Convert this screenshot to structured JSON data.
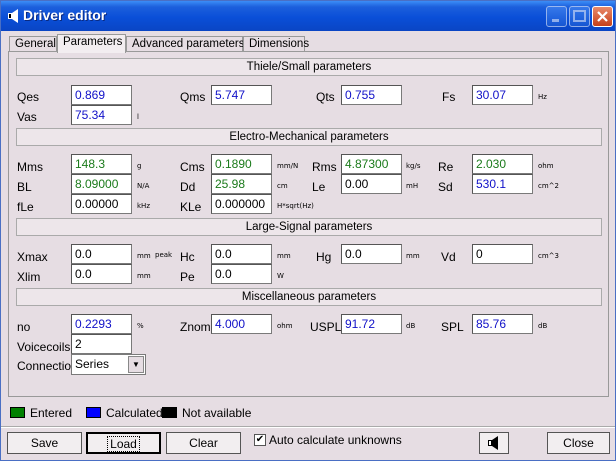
{
  "window": {
    "title": "Driver editor"
  },
  "tabs": [
    "General",
    "Parameters",
    "Advanced parameters",
    "Dimensions"
  ],
  "sections": {
    "ts": "Thiele/Small parameters",
    "em": "Electro-Mechanical parameters",
    "ls": "Large-Signal parameters",
    "misc": "Miscellaneous parameters"
  },
  "fields": {
    "qes": {
      "label": "Qes",
      "value": "0.869",
      "unit": ""
    },
    "qms": {
      "label": "Qms",
      "value": "5.747",
      "unit": ""
    },
    "qts": {
      "label": "Qts",
      "value": "0.755",
      "unit": ""
    },
    "fs": {
      "label": "Fs",
      "value": "30.07",
      "unit": "Hz"
    },
    "vas": {
      "label": "Vas",
      "value": "75.34",
      "unit": "l"
    },
    "mms": {
      "label": "Mms",
      "value": "148.3",
      "unit": "g"
    },
    "cms": {
      "label": "Cms",
      "value": "0.1890",
      "unit": "mm/N"
    },
    "rms": {
      "label": "Rms",
      "value": "4.87300",
      "unit": "kg/s"
    },
    "re": {
      "label": "Re",
      "value": "2.030",
      "unit": "ohm"
    },
    "bl": {
      "label": "BL",
      "value": "8.09000",
      "unit": "N/A"
    },
    "dd": {
      "label": "Dd",
      "value": "25.98",
      "unit": "cm"
    },
    "le": {
      "label": "Le",
      "value": "0.00",
      "unit": "mH"
    },
    "sd": {
      "label": "Sd",
      "value": "530.1",
      "unit": "cm^2"
    },
    "fle": {
      "label": "fLe",
      "value": "0.00000",
      "unit": "kHz"
    },
    "kle": {
      "label": "KLe",
      "value": "0.000000",
      "unit": "H*sqrt(Hz)"
    },
    "xmax": {
      "label": "Xmax",
      "value": "0.0",
      "unit": "mm",
      "extra": "peak"
    },
    "hc": {
      "label": "Hc",
      "value": "0.0",
      "unit": "mm"
    },
    "hg": {
      "label": "Hg",
      "value": "0.0",
      "unit": "mm"
    },
    "vd": {
      "label": "Vd",
      "value": "0",
      "unit": "cm^3"
    },
    "xlim": {
      "label": "Xlim",
      "value": "0.0",
      "unit": "mm"
    },
    "pe": {
      "label": "Pe",
      "value": "0.0",
      "unit": "W"
    },
    "no": {
      "label": "no",
      "value": "0.2293",
      "unit": "%"
    },
    "znom": {
      "label": "Znom",
      "value": "4.000",
      "unit": "ohm"
    },
    "uspl": {
      "label": "USPL",
      "value": "91.72",
      "unit": "dB"
    },
    "spl": {
      "label": "SPL",
      "value": "85.76",
      "unit": "dB"
    },
    "voicecoils": {
      "label": "Voicecoils",
      "value": "2"
    },
    "connection": {
      "label": "Connection",
      "value": "Series"
    }
  },
  "legend": {
    "entered": {
      "label": "Entered",
      "color": "#008000"
    },
    "calculated": {
      "label": "Calculated",
      "color": "#0000ff"
    },
    "na": {
      "label": "Not available",
      "color": "#000000"
    }
  },
  "buttons": {
    "save": "Save",
    "load": "Load",
    "clear": "Clear",
    "auto_calc": "Auto calculate unknowns",
    "auto_calc_checked": true,
    "close": "Close"
  },
  "colors": {
    "entered": "#1a7a1a",
    "calculated": "#1010c8",
    "titlebar": "#0a4fd8"
  }
}
